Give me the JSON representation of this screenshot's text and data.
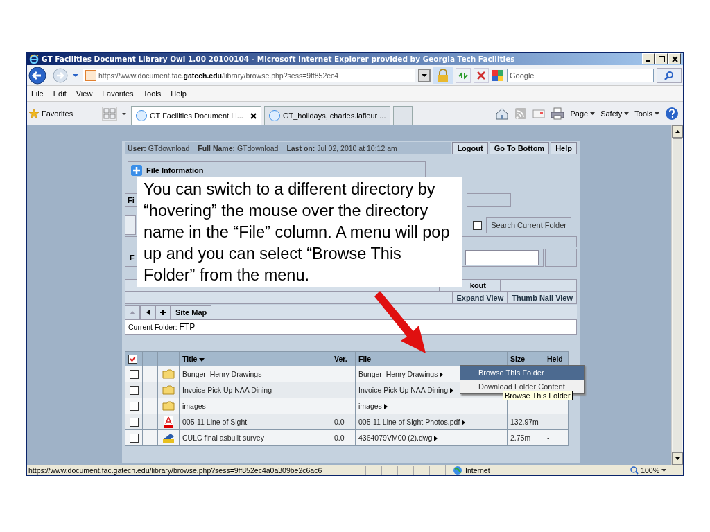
{
  "window": {
    "title": "GT Facilities Document Library Owl 1.00 20100104 - Microsoft Internet Explorer provided by Georgia Tech Facilities"
  },
  "address_bar": {
    "url_prefix": "https://www.document.fac.",
    "url_host": "gatech.edu",
    "url_rest": "/library/browse.php?sess=9ff852ec4",
    "search_placeholder": "Google"
  },
  "menu": [
    "File",
    "Edit",
    "View",
    "Favorites",
    "Tools",
    "Help"
  ],
  "favorites_bar": {
    "label": "Favorites",
    "tabs": [
      {
        "label": "GT Facilities Document Li...",
        "selected": true
      },
      {
        "label": "GT_holidays, charles.lafleur ...",
        "selected": false
      }
    ],
    "commands": [
      "Page",
      "Safety",
      "Tools"
    ]
  },
  "user_bar": {
    "user_label": "User:",
    "user": "GTdownload",
    "full_name_label": "Full Name:",
    "full_name": "GTdownload",
    "last_on_label": "Last on:",
    "last_on": "Jul 02, 2010 at 10:12 am",
    "buttons": [
      "Logout",
      "Go To Bottom",
      "Help"
    ]
  },
  "file_info": {
    "label": "File Information"
  },
  "partial_labels": [
    "Fi",
    "F"
  ],
  "search": {
    "checked": false,
    "label": "Search Current Folder"
  },
  "view_bar": {
    "column_1": "kout",
    "buttons": [
      "Expand View",
      "Thumb Nail View"
    ]
  },
  "nav": {
    "site_map": "Site Map"
  },
  "current_folder": {
    "label": "Current Folder:",
    "value": "FTP"
  },
  "table": {
    "columns": [
      "Title",
      "Ver.",
      "File",
      "Size",
      "Held"
    ],
    "all_checked": true,
    "rows": [
      {
        "checked": false,
        "kind": "folder",
        "title": "Bunger_Henry Drawings",
        "file": "Bunger_Henry Drawings"
      },
      {
        "checked": false,
        "kind": "folder",
        "title": "Invoice Pick Up NAA Dining",
        "file": "Invoice Pick Up NAA Dining"
      },
      {
        "checked": false,
        "kind": "folder",
        "title": "images",
        "file": "images"
      },
      {
        "checked": false,
        "kind": "pdf",
        "title": "005-11 Line of Sight",
        "ver": "0.0",
        "file": "005-11 Line of Sight Photos.pdf",
        "size": "132.97m",
        "held": "-"
      },
      {
        "checked": false,
        "kind": "drawing",
        "title": "CULC final asbuilt survey",
        "ver": "0.0",
        "file": "4364079VM00 (2).dwg",
        "size": "2.75m",
        "held": "-"
      }
    ]
  },
  "context_menu": {
    "items": [
      {
        "label": "Browse This Folder",
        "selected": true
      },
      {
        "label": "Download Folder Content",
        "selected": false
      }
    ]
  },
  "tooltip": "Browse This Folder",
  "callout": "You can switch to a different directory by “hovering” the mouse over the directory name in the “File” column.  A menu will pop up and you can select “Browse This Folder” from the menu.",
  "status_bar": {
    "url": "https://www.document.fac.gatech.edu/library/browse.php?sess=9ff852ec4a0a309be2c6ac6",
    "zone": "Internet",
    "zoom": "100%"
  }
}
